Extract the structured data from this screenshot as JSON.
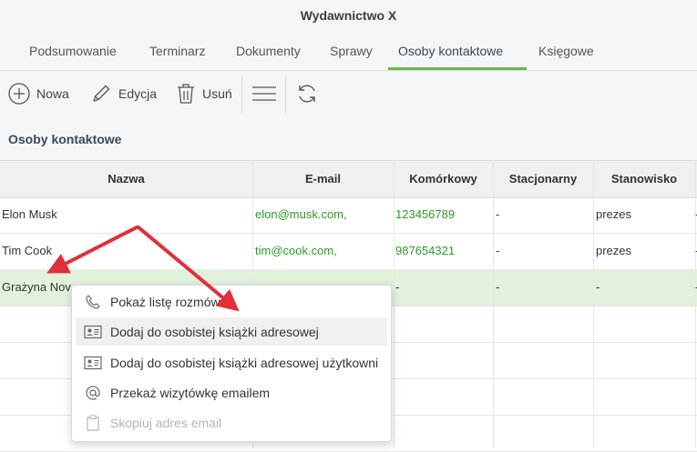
{
  "window": {
    "title": "Wydawnictwo X"
  },
  "tabs": [
    {
      "label": "Podsumowanie",
      "active": false
    },
    {
      "label": "Terminarz",
      "active": false
    },
    {
      "label": "Dokumenty",
      "active": false
    },
    {
      "label": "Sprawy",
      "active": false
    },
    {
      "label": "Osoby kontaktowe",
      "active": true
    },
    {
      "label": "Księgowe",
      "active": false
    }
  ],
  "toolbar": {
    "new_label": "Nowa",
    "edit_label": "Edycja",
    "delete_label": "Usuń"
  },
  "section": {
    "title": "Osoby kontaktowe"
  },
  "table": {
    "columns": [
      "Nazwa",
      "E-mail",
      "Komórkowy",
      "Stacjonarny",
      "Stanowisko"
    ],
    "rows": [
      {
        "name": "Elon Musk",
        "email": "elon@musk.com,",
        "mobile": "123456789",
        "landline": "-",
        "position": "prezes",
        "extra": "-"
      },
      {
        "name": "Tim Cook",
        "email": "tim@cook.com,",
        "mobile": "987654321",
        "landline": "-",
        "position": "prezes",
        "extra": "-"
      },
      {
        "name": "Grażyna Nov",
        "email": "",
        "mobile": "-",
        "landline": "-",
        "position": "-",
        "extra": "-"
      }
    ]
  },
  "context_menu": {
    "items": [
      {
        "label": "Pokaż listę rozmów",
        "icon": "phone-icon",
        "enabled": true
      },
      {
        "label": "Dodaj do osobistej książki adresowej",
        "icon": "contact-card-icon",
        "enabled": true
      },
      {
        "label": "Dodaj do osobistej książki adresowej użytkowni",
        "icon": "contact-card-icon",
        "enabled": true
      },
      {
        "label": "Przekaż wizytówkę emailem",
        "icon": "at-sign-icon",
        "enabled": true
      },
      {
        "label": "Skopiuj adres email",
        "icon": "clipboard-icon",
        "enabled": false
      }
    ]
  },
  "colors": {
    "accent": "#6ab64b",
    "link": "#2e9a24",
    "selected_row": "#e2f1dc",
    "annotation_arrow": "#e0303a"
  }
}
